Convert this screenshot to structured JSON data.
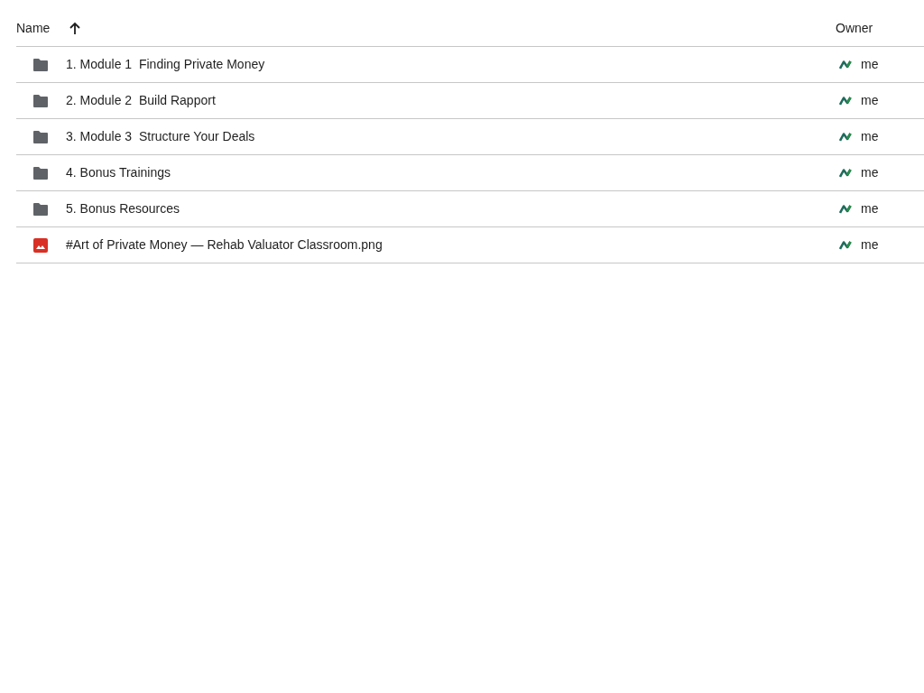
{
  "columns": [
    {
      "label": "Name",
      "sort_ascending": true
    },
    {
      "label": "Owner"
    }
  ],
  "rows": [
    {
      "kind": "folder",
      "name": "1. Module 1  Finding Private Money",
      "owner": "me"
    },
    {
      "kind": "folder",
      "name": "2. Module 2  Build Rapport",
      "owner": "me"
    },
    {
      "kind": "folder",
      "name": "3. Module 3  Structure Your Deals",
      "owner": "me"
    },
    {
      "kind": "folder",
      "name": "4. Bonus Trainings",
      "owner": "me"
    },
    {
      "kind": "folder",
      "name": "5. Bonus Resources",
      "owner": "me"
    },
    {
      "kind": "image",
      "name": "#Art of Private Money — Rehab Valuator Classroom.png",
      "owner": "me"
    }
  ]
}
